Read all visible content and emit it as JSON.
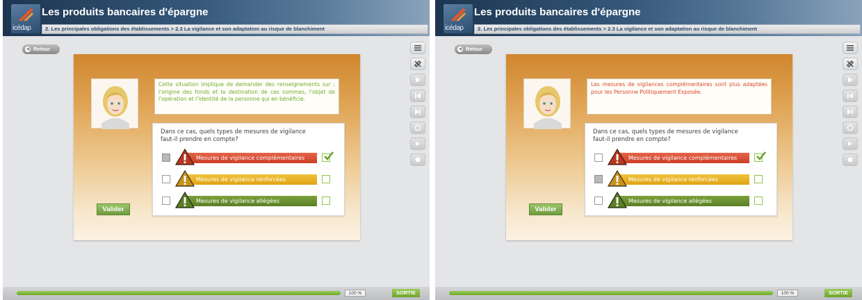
{
  "header": {
    "title": "Les produits bancaires d'épargne",
    "breadcrumb": "2. Les principales obligations des établissements > 2.3 La vigilance et son adaptation au risque de blanchiment",
    "logo_text": "icédap"
  },
  "nav": {
    "back_label": "Retour"
  },
  "toolbar": {
    "icons": [
      "menu-icon",
      "tools-icon",
      "play-icon",
      "first-icon",
      "last-icon",
      "replay-icon",
      "audio-icon",
      "zoom-icon"
    ]
  },
  "question": {
    "prompt": "Dans ce cas, quels types de mesures de vigilance faut-il prendre en compte?",
    "options": [
      {
        "label": "Mesures de vigilance complémentaires",
        "color": "#d9472b"
      },
      {
        "label": "Mesures de vigilance renforcées",
        "color": "#e6ad1e"
      },
      {
        "label": "Mesures de vigilance allégées",
        "color": "#6a8f2f"
      }
    ],
    "validate_label": "Valider"
  },
  "screens": [
    {
      "feedback": "Cette situation implique de demander des renseignements sur : l'origine des fonds et la destination de ces sommes, l'objet de l'opération et l'identité de la personne qui en bénéficie.",
      "feedback_color": "green",
      "selected_option": 0,
      "correct_option": 0
    },
    {
      "feedback": "Les mesures de vigilances complémentaires sont plus adaptées pour les Personne Politiquement Exposée.",
      "feedback_color": "red",
      "selected_option": 1,
      "correct_option": 0
    }
  ],
  "footer": {
    "progress_label": "100 %",
    "progress_value": 1.0,
    "exit_label": "SORTIE"
  },
  "colors": {
    "header_dark": "#1d3550",
    "accent_green": "#6fa32c",
    "panel_orange": "#d0862e"
  }
}
